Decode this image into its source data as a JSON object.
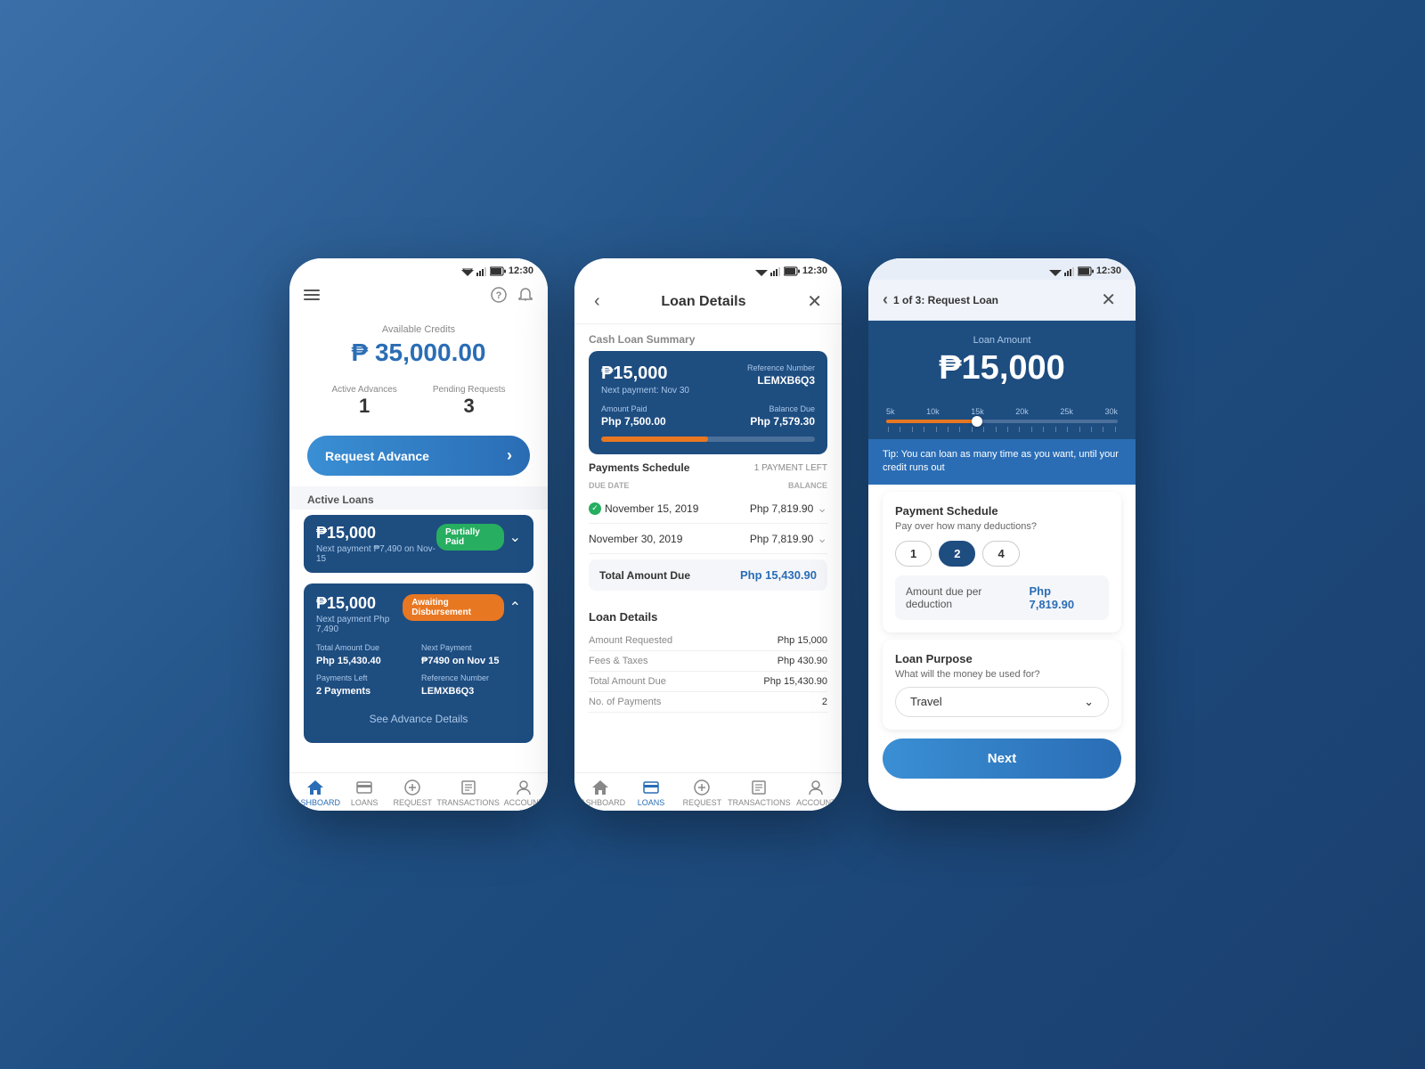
{
  "screens": {
    "screen1": {
      "statusBar": {
        "time": "12:30"
      },
      "availableCredits": {
        "label": "Available Credits",
        "amount": "₱ 35,000.00"
      },
      "stats": {
        "activeAdvances": {
          "label": "Active Advances",
          "value": "1"
        },
        "pendingRequests": {
          "label": "Pending Requests",
          "value": "3"
        }
      },
      "requestBtn": "Request Advance",
      "activeLoansLabel": "Active Loans",
      "loans": [
        {
          "amount": "₱15,000",
          "nextPayment": "Next payment ₱7,490 on Nov-15",
          "badge": "Partially Paid",
          "badgeType": "green",
          "expanded": false
        },
        {
          "amount": "₱15,000",
          "nextPayment": "Next payment Php 7,490",
          "badge": "Awaiting Disbursement",
          "badgeType": "orange",
          "expanded": true,
          "totalAmountDue": {
            "label": "Total Amount Due",
            "value": "Php 15,430.40"
          },
          "nextPayment2": {
            "label": "Next Payment",
            "value": "₱7490 on Nov 15"
          },
          "paymentsLeft": {
            "label": "Payments Left",
            "value": "2 Payments"
          },
          "referenceNumber": {
            "label": "Reference Number",
            "value": "LEMXB6Q3"
          }
        }
      ],
      "seeDetails": "See Advance Details",
      "nav": [
        {
          "label": "DASHBOARD",
          "active": true,
          "icon": "home-icon"
        },
        {
          "label": "LOANS",
          "active": false,
          "icon": "loans-icon"
        },
        {
          "label": "REQUEST",
          "active": false,
          "icon": "request-icon"
        },
        {
          "label": "TRANSACTIONS",
          "active": false,
          "icon": "transactions-icon"
        },
        {
          "label": "ACCOUNT",
          "active": false,
          "icon": "account-icon"
        }
      ]
    },
    "screen2": {
      "statusBar": {
        "time": "12:30"
      },
      "title": "Loan Details",
      "cashLoanSummaryLabel": "Cash Loan Summary",
      "summaryCard": {
        "amount": "₱15,000",
        "nextPayment": "Next payment: Nov 30",
        "refNumberLabel": "Reference Number",
        "refNumber": "LEMXB6Q3",
        "amountPaidLabel": "Amount Paid",
        "amountPaid": "Php 7,500.00",
        "balanceDueLabel": "Balance Due",
        "balanceDue": "Php 7,579.30",
        "progressPercent": 50
      },
      "paymentsSchedule": {
        "title": "Payments Schedule",
        "badge": "1 PAYMENT LEFT",
        "dueDateHeader": "DUE DATE",
        "balanceHeader": "BALANCE",
        "rows": [
          {
            "date": "November 15, 2019",
            "amount": "Php 7,819.90",
            "paid": true
          },
          {
            "date": "November 30, 2019",
            "amount": "Php 7,819.90",
            "paid": false
          }
        ],
        "totalDueLabel": "Total Amount Due",
        "totalDueAmount": "Php 15,430.90"
      },
      "loanDetails": {
        "title": "Loan Details",
        "rows": [
          {
            "label": "Amount Requested",
            "value": "Php 15,000"
          },
          {
            "label": "Fees & Taxes",
            "value": "Php 430.90"
          },
          {
            "label": "Total Amount Due",
            "value": "Php 15,430.90"
          },
          {
            "label": "No. of Payments",
            "value": "2"
          }
        ]
      },
      "nav": [
        {
          "label": "DASHBOARD",
          "active": false,
          "icon": "home-icon"
        },
        {
          "label": "LOANS",
          "active": true,
          "icon": "loans-icon"
        },
        {
          "label": "REQUEST",
          "active": false,
          "icon": "request-icon"
        },
        {
          "label": "TRANSACTIONS",
          "active": false,
          "icon": "transactions-icon"
        },
        {
          "label": "ACCOUNT",
          "active": false,
          "icon": "account-icon"
        }
      ]
    },
    "screen3": {
      "statusBar": {
        "time": "12:30"
      },
      "stepLabel": "1 of 3: Request Loan",
      "loanAmountLabel": "Loan Amount",
      "loanAmount": "₱15,000",
      "sliderLabels": [
        "5k",
        "10k",
        "15k",
        "20k",
        "25k",
        "30k"
      ],
      "sliderPosition": 38,
      "tip": "Tip: You can loan as many time as you want, until your credit runs out",
      "paymentSchedule": {
        "title": "Payment Schedule",
        "subtitle": "Pay over how many deductions?",
        "options": [
          {
            "label": "1",
            "active": false
          },
          {
            "label": "2",
            "active": true
          },
          {
            "label": "4",
            "active": false
          }
        ],
        "amountPerLabel": "Amount due per deduction",
        "amountPerValue": "Php 7,819.90"
      },
      "loanPurpose": {
        "title": "Loan Purpose",
        "subtitle": "What will the money be used for?",
        "selected": "Travel"
      },
      "nextBtn": "Next"
    }
  }
}
